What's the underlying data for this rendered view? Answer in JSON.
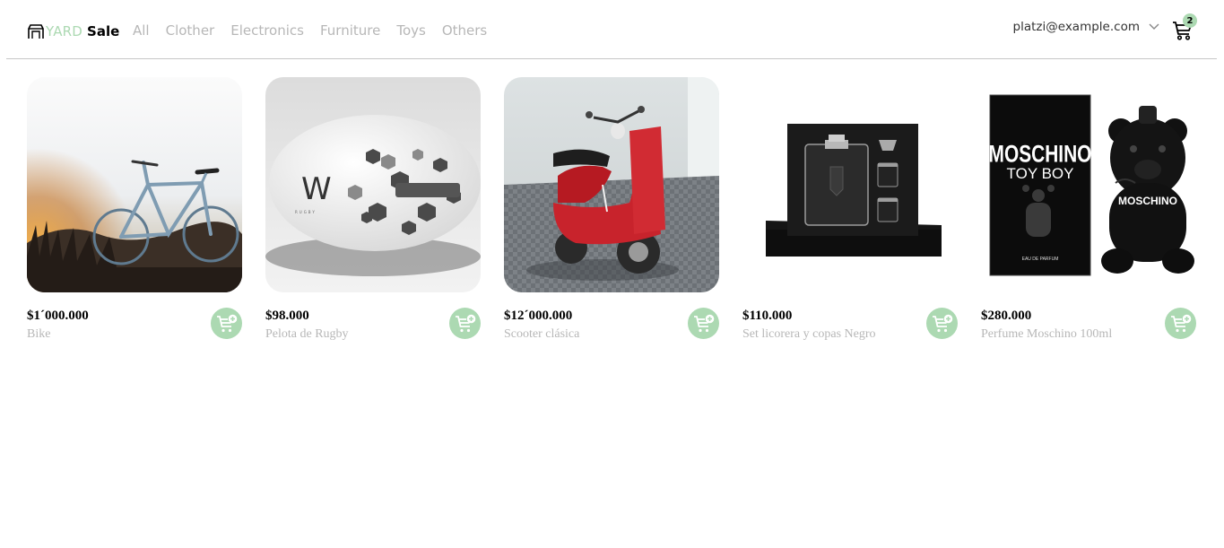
{
  "header": {
    "logo": {
      "part1": "YARD",
      "part2": "Sale",
      "icon": "storefront-icon"
    },
    "nav": [
      "All",
      "Clother",
      "Electronics",
      "Furniture",
      "Toys",
      "Others"
    ],
    "email": "platzi@example.com",
    "cart_count": "2"
  },
  "colors": {
    "accent": "#acd9b2",
    "muted_text": "#b7b7b7",
    "divider": "#c7c7c7"
  },
  "products": [
    {
      "price": "$1´000.000",
      "name": "Bike",
      "image": "bicycle-at-sunset-photo"
    },
    {
      "price": "$98.000",
      "name": "Pelota de Rugby",
      "image": "rugby-ball-photo"
    },
    {
      "price": "$12´000.000",
      "name": "Scooter clásica",
      "image": "red-scooter-photo"
    },
    {
      "price": "$110.000",
      "name": "Set licorera y copas Negro",
      "image": "flask-gift-set-photo"
    },
    {
      "price": "$280.000",
      "name": "Perfume Moschino 100ml",
      "image": "perfume-bottle-photo",
      "image_text": [
        "MOSCHINO",
        "TOY BOY",
        "MOSCHINO",
        "EAU DE PARFUM"
      ]
    }
  ]
}
